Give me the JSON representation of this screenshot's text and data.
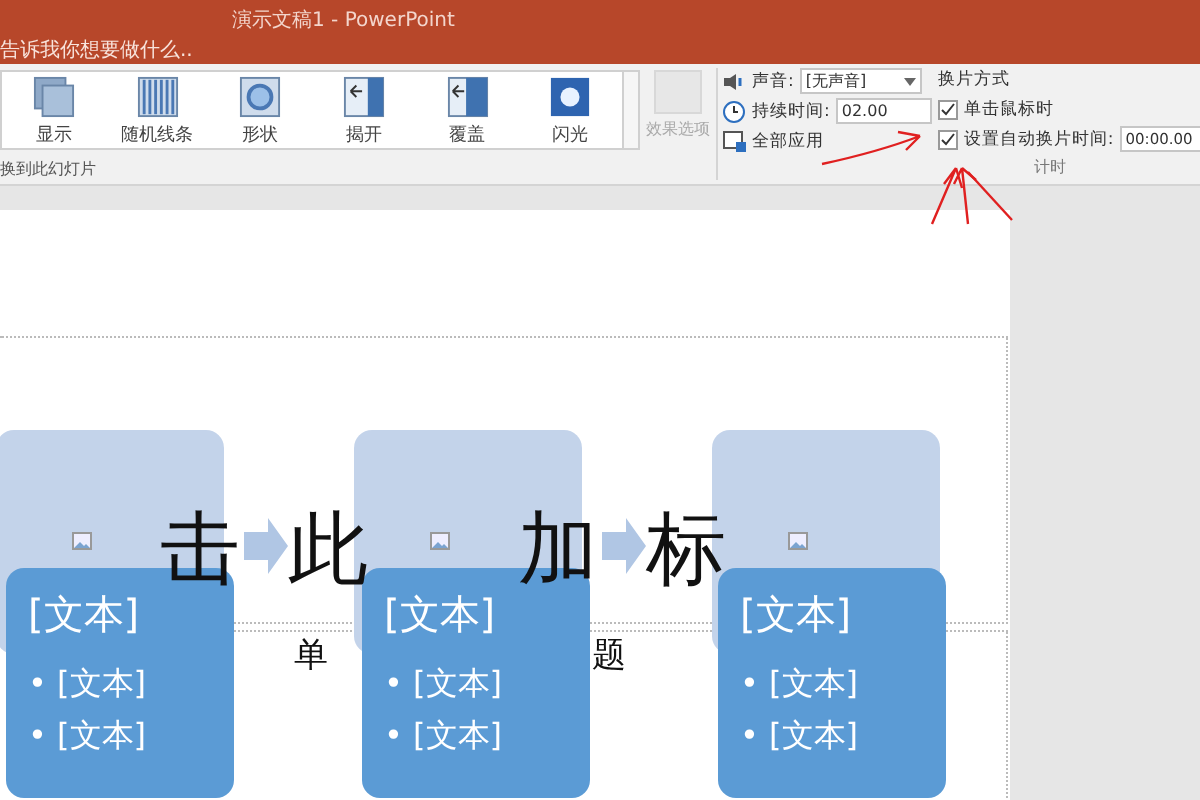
{
  "title_bar": {
    "title": "演示文稿1 - PowerPoint",
    "tell_me": "告诉我你想要做什么.."
  },
  "ribbon": {
    "transitions": [
      {
        "label": "显示",
        "kind": "fade"
      },
      {
        "label": "随机线条",
        "kind": "bars"
      },
      {
        "label": "形状",
        "kind": "shape"
      },
      {
        "label": "揭开",
        "kind": "uncover"
      },
      {
        "label": "覆盖",
        "kind": "cover"
      },
      {
        "label": "闪光",
        "kind": "flash"
      }
    ],
    "effect_options": {
      "label": "效果选项",
      "disabled": true
    },
    "group_label": "换到此幻灯片",
    "timing": {
      "sound": {
        "label": "声音:",
        "value": "[无声音]"
      },
      "duration": {
        "label": "持续时间:",
        "value": "02.00"
      },
      "apply_all": {
        "label": "全部应用"
      },
      "advance_heading": "换片方式",
      "on_click": {
        "label": "单击鼠标时",
        "checked": true
      },
      "after": {
        "label": "设置自动换片时间:",
        "checked": true,
        "value": "00:00.00"
      },
      "group_label": "计时"
    }
  },
  "slide": {
    "title_fragments": [
      "击",
      "此",
      "加",
      "标"
    ],
    "subtitle_fragments": [
      "单",
      "题"
    ],
    "items": [
      {
        "heading": "[文本]",
        "bullets": [
          "• [文本]",
          "• [文本]"
        ]
      },
      {
        "heading": "[文本]",
        "bullets": [
          "• [文本]",
          "• [文本]"
        ]
      },
      {
        "heading": "[文本]",
        "bullets": [
          "• [文本]",
          "• [文本]"
        ]
      }
    ]
  }
}
